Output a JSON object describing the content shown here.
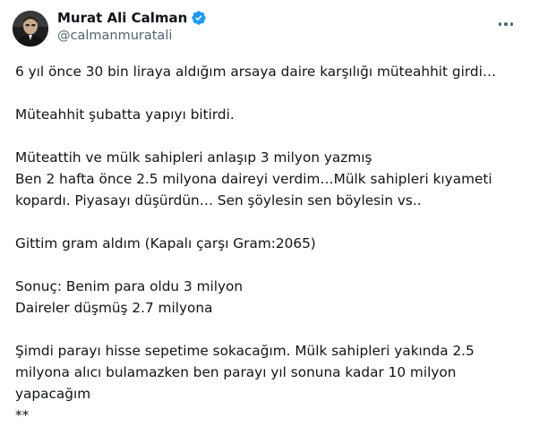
{
  "author": {
    "display_name": "Murat Ali Calman",
    "handle": "@calmanmuratali",
    "verified": true,
    "verified_color": "#1d9bf0"
  },
  "icons": {
    "verified": "verified-badge-icon",
    "more": "more-horizontal-icon"
  },
  "tweet": {
    "paragraphs": [
      "6 yıl önce 30 bin liraya aldığım arsaya daire karşılığı müteahhit girdi…",
      "Müteahhit şubatta yapıyı bitirdi.",
      "Müteattih ve mülk sahipleri anlaşıp 3 milyon yazmış\nBen 2 hafta önce 2.5 milyona daireyi verdim…Mülk sahipleri kıyameti kopardı. Piyasayı düşürdün… Sen şöylesin sen böylesin vs..",
      "Gittim gram aldım (Kapalı çarşı Gram:2065)",
      "Sonuç: Benim para oldu 3 milyon\nDaireler düşmüş 2.7 milyona",
      "Şimdi parayı hisse sepetime sokacağım. Mülk sahipleri yakında 2.5 milyona alıcı bulamazken ben parayı yıl sonuna kadar 10 milyon yapacağım\n**"
    ]
  }
}
